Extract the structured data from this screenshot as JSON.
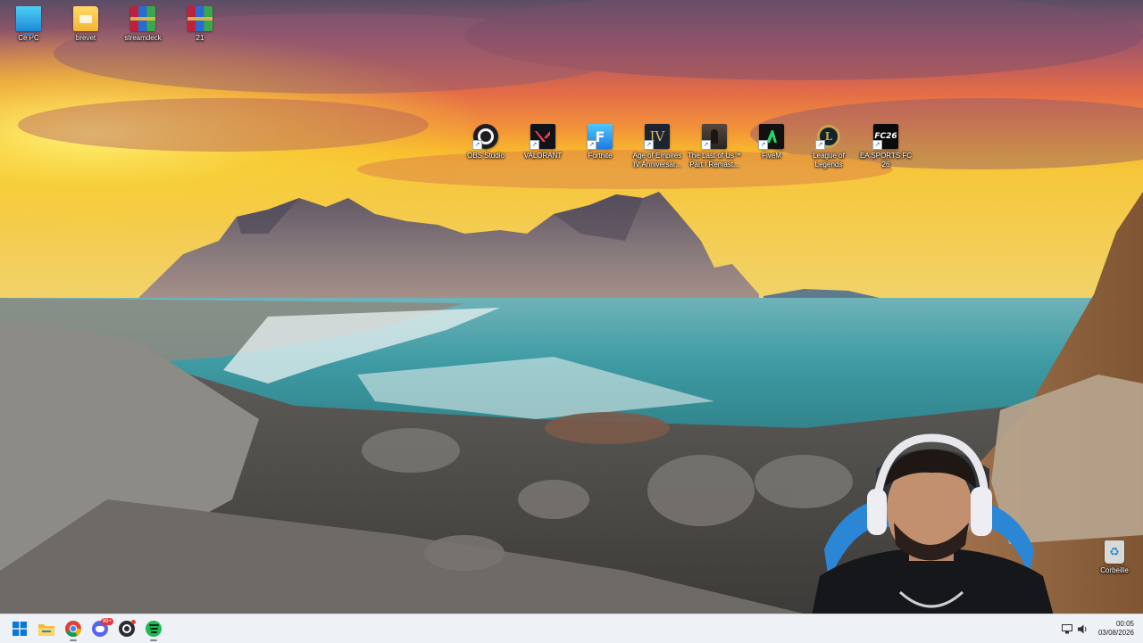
{
  "desktop_left_icons": [
    {
      "label": "Ce PC",
      "icon": "computer-icon"
    },
    {
      "label": "brevet",
      "icon": "folder-icon"
    },
    {
      "label": "streamdeck",
      "icon": "winrar-archive-icon"
    },
    {
      "label": "21",
      "icon": "winrar-archive-icon"
    }
  ],
  "desktop_game_icons": [
    {
      "label": "OBS Studio",
      "icon": "obs-studio-icon"
    },
    {
      "label": "VALORANT",
      "icon": "valorant-icon"
    },
    {
      "label": "Fortnite",
      "icon": "fortnite-icon"
    },
    {
      "label": "Age of Empires IV Anniversar...",
      "icon": "age-of-empires-icon"
    },
    {
      "label": "The Last of Us™ Part I Remast...",
      "icon": "last-of-us-icon"
    },
    {
      "label": "FiveM",
      "icon": "fivem-icon"
    },
    {
      "label": "League of Legends",
      "icon": "league-of-legends-icon"
    },
    {
      "label": "EA SPORTS FC 26",
      "icon": "ea-sports-fc-icon"
    }
  ],
  "recycle_bin": {
    "label": "Corbeille",
    "icon": "recycle-bin-icon"
  },
  "taskbar": {
    "apps": [
      "windows-start-icon",
      "file-explorer-icon",
      "chrome-icon",
      "discord-icon",
      "obs-icon",
      "spotify-icon"
    ],
    "discord_badge": "99+",
    "clock": {
      "time": "00:05",
      "date": "03/08/2026"
    }
  },
  "colors": {
    "taskbar_bg": "#eef1f5",
    "label_text": "#ffffff",
    "accent": "#0a64d8"
  }
}
